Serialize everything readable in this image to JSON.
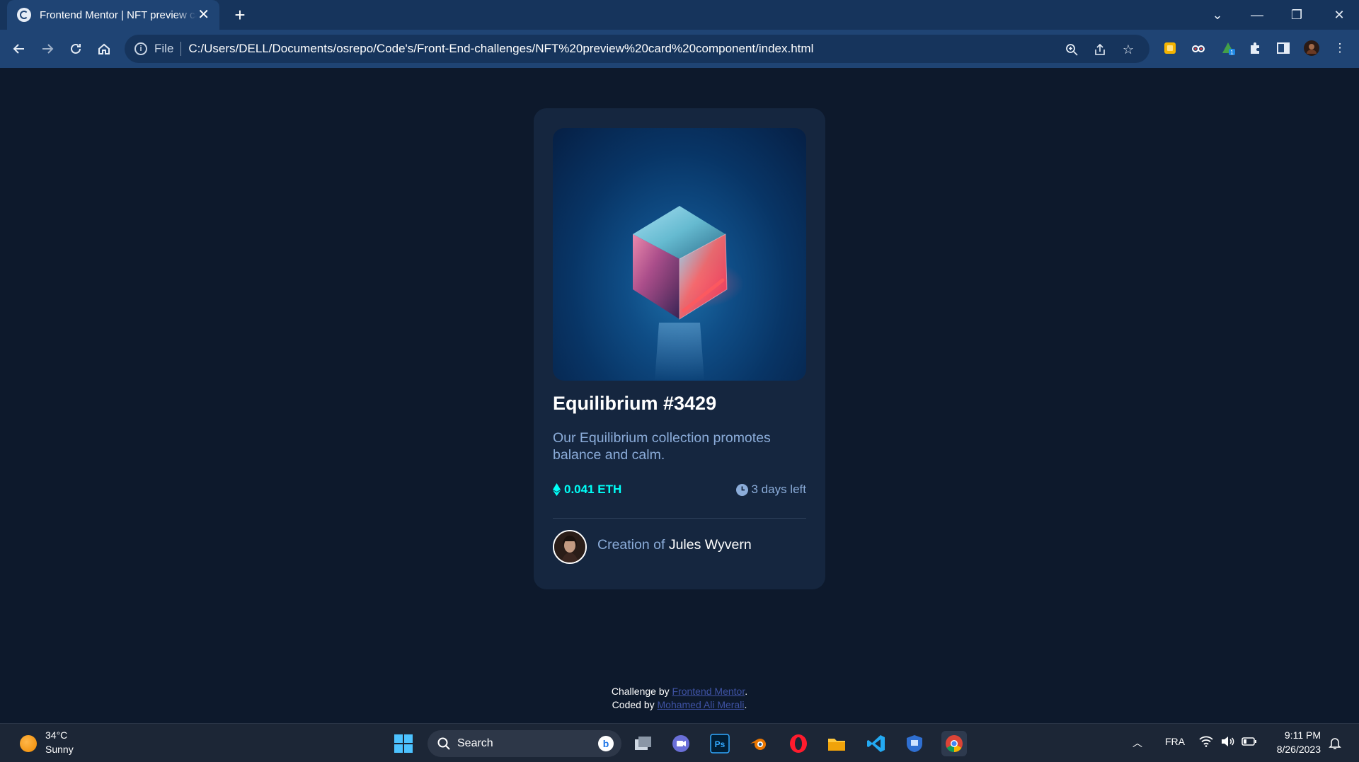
{
  "browser": {
    "tab_title": "Frontend Mentor | NFT preview card component",
    "tab_close": "✕",
    "new_tab": "+",
    "scheme_label": "File",
    "url": "C:/Users/DELL/Documents/osrepo/Code's/Front-End-challenges/NFT%20preview%20card%20component/index.html"
  },
  "card": {
    "title": "Equilibrium #3429",
    "description": "Our Equilibrium collection promotes balance and calm.",
    "price": "0.041 ETH",
    "time_left": "3 days left",
    "creator_prefix": "Creation of",
    "creator_name": "Jules Wyvern"
  },
  "attribution": {
    "line1_prefix": "Challenge by",
    "line1_link": "Frontend Mentor",
    "line2_prefix": "Coded by",
    "line2_link": "Mohamed Ali Merali"
  },
  "taskbar": {
    "weather_temp": "34°C",
    "weather_desc": "Sunny",
    "search_label": "Search",
    "language": "FRA",
    "time": "9:11 PM",
    "date": "8/26/2023"
  },
  "colors": {
    "page_bg": "#0d192c",
    "card_bg": "#15263f",
    "accent_cyan": "#00fff7",
    "soft_blue": "#8bacd9",
    "browser_frame": "#1f4474"
  }
}
